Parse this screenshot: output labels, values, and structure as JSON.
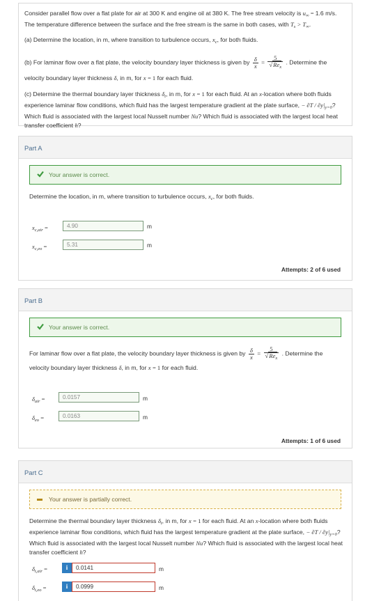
{
  "problem": {
    "intro_1": "Consider parallel flow over a flat plate for air at 300 K and engine oil at 380 K. The free stream velocity is",
    "velocity": "1.6",
    "intro_2": "m/s. The temperature difference between the surface and the free stream is the same in both cases, with",
    "part_a": "(a) Determine the location, in m, where transition to turbulence occurs,",
    "part_a_end": ", for both fluids.",
    "part_b_1": "(b) For laminar flow over a flat plate, the velocity boundary layer thickness is given by",
    "part_b_2": ". Determine the",
    "part_b_3": "velocity boundary layer thickness",
    "part_b_4": ", in m, for",
    "part_b_5": "for each fluid.",
    "part_c_1": "(c) Determine the thermal boundary layer thickness",
    "part_c_2": ", in m, for",
    "part_c_3": "for each fluid. At an",
    "part_c_4": "-location where both",
    "part_c_5": "fluids experience laminar flow conditions, which fluid has the largest temperature gradient at the plate surface,",
    "part_c_6": "? Which fluid is associated with the largest local Nusselt number",
    "part_c_7": "? Which fluid is associated with the largest",
    "part_c_8": "local heat transfer coefficient"
  },
  "part_a": {
    "title": "Part A",
    "banner": "Your answer is correct.",
    "question_1": "Determine the location, in m, where transition to turbulence occurs,",
    "question_2": ", for both fluids.",
    "inputs": [
      {
        "label": "x",
        "sub": "c,air",
        "value": "4.90",
        "unit": "m"
      },
      {
        "label": "x",
        "sub": "c,eo",
        "value": "5.31",
        "unit": "m"
      }
    ],
    "attempts": "Attempts: 2 of 6 used"
  },
  "part_b": {
    "title": "Part B",
    "banner": "Your answer is correct.",
    "question_1": "For laminar flow over a flat plate, the velocity boundary layer thickness is given by",
    "question_2": ". Determine the",
    "question_3": "velocity boundary layer thickness",
    "question_4": ", in m, for",
    "question_5": "for each fluid.",
    "inputs": [
      {
        "label": "δ",
        "sub": "air",
        "value": "0.0157",
        "unit": "m"
      },
      {
        "label": "δ",
        "sub": "eo",
        "value": "0.0163",
        "unit": "m"
      }
    ],
    "attempts": "Attempts: 1 of 6 used"
  },
  "part_c": {
    "title": "Part C",
    "banner": "Your answer is partially correct.",
    "question_1": "Determine the thermal boundary layer thickness",
    "question_2": ", in m, for",
    "question_3": "for each fluid. At an",
    "question_4": "-location where both",
    "question_5": "fluids experience laminar flow conditions, which fluid has the largest temperature gradient at the plate surface,",
    "question_6": "? Which fluid is associated with the largest local Nusselt number",
    "question_7": "? Which fluid is associated with",
    "question_8": "the largest local heat transfer coefficient",
    "inputs": [
      {
        "label": "δ",
        "sub": "t,air",
        "value": "0.0141",
        "unit": "m"
      },
      {
        "label": "δ",
        "sub": "t,eo",
        "value": "0.0999",
        "unit": "m"
      }
    ],
    "info_glyph": "i"
  },
  "colors": {
    "correct_border": "#3f9b3f",
    "correct_bg": "#edf7ea",
    "partial_border": "#d8b14a",
    "partial_bg": "#fdf9e6",
    "info_blue": "#2f7ec1",
    "wrong_red": "#c0392b",
    "part_title": "#4a6d8f"
  }
}
